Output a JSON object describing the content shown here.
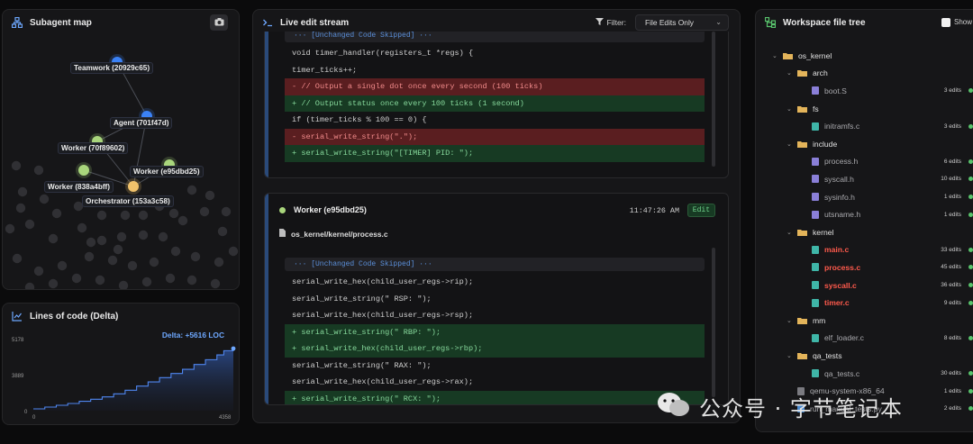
{
  "subagent_map": {
    "title": "Subagent map",
    "nodes": [
      {
        "label": "Teamwork (20929c65)"
      },
      {
        "label": "Agent (701f47d)"
      },
      {
        "label": "Worker (70f89602)"
      },
      {
        "label": "Worker (e95dbd25)"
      },
      {
        "label": "Worker (838a4bff)"
      },
      {
        "label": "Orchestrator (153a3c58)"
      }
    ]
  },
  "loc_chart": {
    "title": "Lines of code (Delta)",
    "delta_label": "Delta: +5616 LOC",
    "chart_data": {
      "type": "area",
      "y_ticks": [
        "5178",
        "3889",
        "0"
      ],
      "x_ticks": [
        "0",
        "4358"
      ],
      "ylim": [
        0,
        5178
      ],
      "xlim": [
        0,
        4358
      ],
      "x": [
        0,
        250,
        500,
        750,
        1000,
        1250,
        1500,
        1750,
        2000,
        2250,
        2500,
        2750,
        3000,
        3250,
        3500,
        3750,
        4000,
        4150,
        4358
      ],
      "y": [
        150,
        300,
        450,
        600,
        780,
        950,
        1150,
        1400,
        1700,
        2050,
        2400,
        2750,
        3100,
        3450,
        3850,
        4250,
        4650,
        5000,
        5178
      ]
    }
  },
  "stream": {
    "title": "Live edit stream",
    "filter_label": "Filter:",
    "filter_value": "File Edits Only",
    "card1": {
      "skip": "··· [Unchanged Code Skipped] ···",
      "lines": [
        {
          "t": "ctx",
          "text": "void timer_handler(registers_t *regs) {"
        },
        {
          "t": "ctx",
          "text": "timer_ticks++;"
        },
        {
          "t": "del",
          "text": "- // Output a single dot once every second (100 ticks)"
        },
        {
          "t": "add",
          "text": "+ // Output status once every 100 ticks (1 second)"
        },
        {
          "t": "ctx",
          "text": "if (timer_ticks % 100 == 0) {"
        },
        {
          "t": "del",
          "text": "- serial_write_string(\".\");"
        },
        {
          "t": "add",
          "text": "+ serial_write_string(\"[TIMER] PID: \");"
        }
      ]
    },
    "card2": {
      "agent": "Worker (e95dbd25)",
      "time": "11:47:26 AM",
      "badge": "Edit",
      "path": "os_kernel/kernel/process.c",
      "skip": "··· [Unchanged Code Skipped] ···",
      "lines": [
        {
          "t": "ctx",
          "text": "serial_write_hex(child_user_regs->rip);"
        },
        {
          "t": "ctx",
          "text": "serial_write_string(\" RSP: \");"
        },
        {
          "t": "ctx",
          "text": "serial_write_hex(child_user_regs->rsp);"
        },
        {
          "t": "add",
          "text": "+ serial_write_string(\" RBP: \");"
        },
        {
          "t": "add",
          "text": "+ serial_write_hex(child_user_regs->rbp);"
        },
        {
          "t": "ctx",
          "text": "serial_write_string(\" RAX: \");"
        },
        {
          "t": "ctx",
          "text": "serial_write_hex(child_user_regs->rax);"
        },
        {
          "t": "add",
          "text": "+ serial_write_string(\" RCX: \");"
        }
      ]
    }
  },
  "tree": {
    "title": "Workspace file tree",
    "show_label": "Show",
    "rows": [
      {
        "kind": "dir",
        "depth": 0,
        "name": "os_kernel",
        "count": "",
        "hot": false
      },
      {
        "kind": "dir",
        "depth": 1,
        "name": "arch",
        "count": "",
        "hot": false
      },
      {
        "kind": "file",
        "depth": 2,
        "name": "boot.S",
        "count": "3 edits",
        "hot": false
      },
      {
        "kind": "dir",
        "depth": 1,
        "name": "fs",
        "count": "",
        "hot": false
      },
      {
        "kind": "file",
        "depth": 2,
        "name": "initramfs.c",
        "count": "3 edits",
        "hot": false
      },
      {
        "kind": "dir",
        "depth": 1,
        "name": "include",
        "count": "",
        "hot": false
      },
      {
        "kind": "file",
        "depth": 2,
        "name": "process.h",
        "count": "6 edits",
        "hot": false
      },
      {
        "kind": "file",
        "depth": 2,
        "name": "syscall.h",
        "count": "10 edits",
        "hot": false
      },
      {
        "kind": "file",
        "depth": 2,
        "name": "sysinfo.h",
        "count": "1 edits",
        "hot": false
      },
      {
        "kind": "file",
        "depth": 2,
        "name": "utsname.h",
        "count": "1 edits",
        "hot": false
      },
      {
        "kind": "dir",
        "depth": 1,
        "name": "kernel",
        "count": "",
        "hot": false
      },
      {
        "kind": "file",
        "depth": 2,
        "name": "main.c",
        "count": "33 edits",
        "hot": true
      },
      {
        "kind": "file",
        "depth": 2,
        "name": "process.c",
        "count": "45 edits",
        "hot": true
      },
      {
        "kind": "file",
        "depth": 2,
        "name": "syscall.c",
        "count": "36 edits",
        "hot": true
      },
      {
        "kind": "file",
        "depth": 2,
        "name": "timer.c",
        "count": "9 edits",
        "hot": true
      },
      {
        "kind": "dir",
        "depth": 1,
        "name": "mm",
        "count": "",
        "hot": false
      },
      {
        "kind": "file",
        "depth": 2,
        "name": "elf_loader.c",
        "count": "8 edits",
        "hot": false
      },
      {
        "kind": "dir",
        "depth": 1,
        "name": "qa_tests",
        "count": "",
        "hot": false
      },
      {
        "kind": "file",
        "depth": 2,
        "name": "qa_tests.c",
        "count": "30 edits",
        "hot": false
      },
      {
        "kind": "file",
        "depth": 1,
        "name": "qemu-system-x86_64",
        "count": "1 edits",
        "hot": false
      },
      {
        "kind": "file",
        "depth": 1,
        "name": "run_manual_tests.py",
        "count": "2 edits",
        "hot": false
      }
    ]
  },
  "watermark": "公众号 · 字节笔记本",
  "colors": {
    "accent_blue": "#3b82f6",
    "worker_green": "#a9d67c",
    "orchestrator_yellow": "#f1c26b",
    "hot_file": "#ff5a4c",
    "edit_dot": "#58c36c"
  }
}
